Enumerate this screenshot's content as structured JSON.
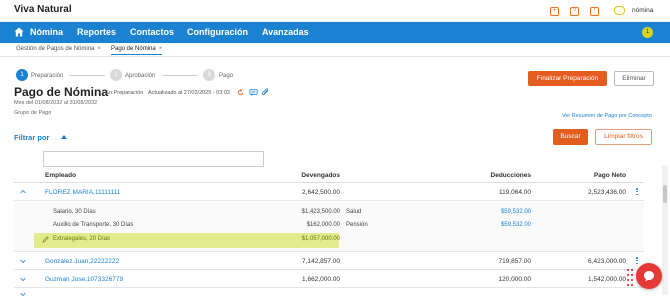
{
  "app": {
    "title": "Viva Natural",
    "user_name": "nómina",
    "nav_badge": "1"
  },
  "top_icons": [
    {
      "name": "plus-icon",
      "glyph": "+"
    },
    {
      "name": "help-icon",
      "glyph": "?"
    },
    {
      "name": "notification-icon",
      "glyph": "!"
    }
  ],
  "nav": {
    "items": [
      "Nómina",
      "Reportes",
      "Contactos",
      "Configuración",
      "Avanzadas"
    ]
  },
  "tabs": [
    {
      "label": "Gestión de Pagos de Nómina"
    },
    {
      "label": "Pago de Nómina"
    }
  ],
  "stepper": {
    "steps": [
      {
        "num": "1",
        "label": "Preparación"
      },
      {
        "num": "2",
        "label": "Aprobación"
      },
      {
        "num": "3",
        "label": "Pago"
      }
    ]
  },
  "actions": {
    "finalize": "Finalizar Preparación",
    "delete": "Eliminar"
  },
  "header": {
    "title": "Pago de Nómina",
    "status": "- En Preparación",
    "updated": "Actualizado al 27/02/2025 - 03:03",
    "period": "Mes del 01/08/2032 al 31/08/2032",
    "group": "Grupo de Pago",
    "summary_link": "Ver Resumen de Pago por Concepto"
  },
  "filters": {
    "label": "Filtrar por",
    "search": "Buscar",
    "clear": "Limpiar filtros"
  },
  "table": {
    "columns": {
      "employee": "Empleado",
      "earnings": "Devengados",
      "deductions": "Deducciones",
      "net": "Pago Neto"
    },
    "rows": [
      {
        "employee": "FLOREZ MARIA,11111111",
        "earnings": "2,642,500.00",
        "deductions": "119,064.00",
        "net": "2,523,436.00"
      },
      {
        "employee": "Gonzalez Juan,22222222",
        "earnings": "7,142,857.00",
        "deductions": "719,857.00",
        "net": "6,423,000.00"
      },
      {
        "employee": "Guzman Jose,1073326779",
        "earnings": "1,662,000.00",
        "deductions": "120,000.00",
        "net": "1,542,000.00"
      }
    ],
    "detail": {
      "items": [
        {
          "label": "Salario, 30 Días",
          "value": "$1,423,500.00"
        },
        {
          "label": "Auxilio de Transporte, 30 Días",
          "value": "$162,000.00"
        },
        {
          "label": "Extralegales, 20 Días",
          "value": "$1,057,000.00"
        }
      ],
      "deductions": [
        {
          "label": "Salud",
          "value": "$59,532.00"
        },
        {
          "label": "Pensión",
          "value": "$59,532.00"
        }
      ]
    }
  },
  "colors": {
    "brand_blue": "#1b82d1",
    "accent_orange": "#e25d1e",
    "highlight": "#e3ec8d",
    "chat_red": "#e53935"
  }
}
